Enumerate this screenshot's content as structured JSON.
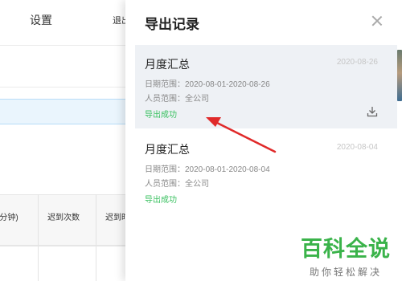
{
  "background": {
    "nav": {
      "settings": "设置",
      "logout": "退出"
    },
    "table_headers": [
      "(分钟)",
      "迟到次数",
      "迟到时"
    ]
  },
  "panel": {
    "title": "导出记录",
    "records": [
      {
        "name": "月度汇总",
        "date": "2020-08-26",
        "range": "日期范围：2020-08-01-2020-08-26",
        "people": "人员范围：全公司",
        "status": "导出成功"
      },
      {
        "name": "月度汇总",
        "date": "2020-08-04",
        "range": "日期范围：2020-08-01-2020-08-04",
        "people": "人员范围：全公司",
        "status": "导出成功"
      }
    ]
  },
  "watermark": {
    "main": "百科全说",
    "sub": "助你轻松解决"
  },
  "colors": {
    "success": "#37c05e",
    "arrow": "#e02a2a",
    "selected_bg": "#eef1f5",
    "watermark": "#3ab34a"
  }
}
